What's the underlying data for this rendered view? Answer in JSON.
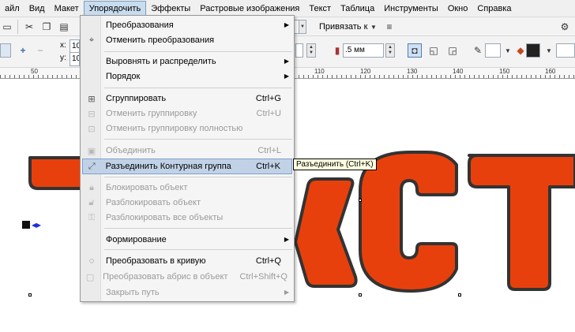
{
  "menubar": {
    "items": [
      "айл",
      "Вид",
      "Макет",
      "Упорядочить",
      "Эффекты",
      "Растровые изображения",
      "Текст",
      "Таблица",
      "Инструменты",
      "Окно",
      "Справка"
    ],
    "active_index": 3
  },
  "toolbar1": {
    "snap_label": "Привязать к",
    "field_value": ""
  },
  "toolbar2": {
    "x_label": "x:",
    "x_value": "10",
    "y_label": "y:",
    "y_value": "10",
    "outline_width": ".5 мм"
  },
  "ruler": {
    "labels": [
      "50",
      "110",
      "120",
      "130",
      "140",
      "150",
      "160"
    ]
  },
  "canvas": {
    "text": "TEКСТ",
    "fill_color": "#e8400c",
    "outline_color": "#333333"
  },
  "dropdown": {
    "items": [
      {
        "label": "Преобразования",
        "shortcut": "",
        "submenu": true,
        "disabled": false,
        "icon": ""
      },
      {
        "label": "Отменить преобразования",
        "shortcut": "",
        "submenu": false,
        "disabled": false,
        "icon": ""
      },
      {
        "label": "Выровнять и распределить",
        "shortcut": "",
        "submenu": true,
        "disabled": false,
        "icon": ""
      },
      {
        "label": "Порядок",
        "shortcut": "",
        "submenu": true,
        "disabled": false,
        "icon": ""
      },
      {
        "label": "Сгруппировать",
        "shortcut": "Ctrl+G",
        "submenu": false,
        "disabled": false,
        "icon": "group-icon"
      },
      {
        "label": "Отменить группировку",
        "shortcut": "Ctrl+U",
        "submenu": false,
        "disabled": true,
        "icon": "ungroup-icon"
      },
      {
        "label": "Отменить группировку полностью",
        "shortcut": "",
        "submenu": false,
        "disabled": true,
        "icon": "ungroup-all-icon"
      },
      {
        "label": "Объединить",
        "shortcut": "Ctrl+L",
        "submenu": false,
        "disabled": true,
        "icon": "combine-icon"
      },
      {
        "label": "Разъединить Контурная группа",
        "shortcut": "Ctrl+K",
        "submenu": false,
        "disabled": false,
        "icon": "break-apart-icon",
        "highlighted": true
      },
      {
        "label": "Блокировать объект",
        "shortcut": "",
        "submenu": false,
        "disabled": true,
        "icon": "lock-icon"
      },
      {
        "label": "Разблокировать объект",
        "shortcut": "",
        "submenu": false,
        "disabled": true,
        "icon": "unlock-icon"
      },
      {
        "label": "Разблокировать все объекты",
        "shortcut": "",
        "submenu": false,
        "disabled": true,
        "icon": "unlock-all-icon"
      },
      {
        "label": "Формирование",
        "shortcut": "",
        "submenu": true,
        "disabled": false,
        "icon": ""
      },
      {
        "label": "Преобразовать в кривую",
        "shortcut": "Ctrl+Q",
        "submenu": false,
        "disabled": false,
        "icon": "convert-to-curves-icon"
      },
      {
        "label": "Преобразовать абрис в объект",
        "shortcut": "Ctrl+Shift+Q",
        "submenu": false,
        "disabled": true,
        "icon": "outline-to-object-icon"
      },
      {
        "label": "Закрыть путь",
        "shortcut": "",
        "submenu": true,
        "disabled": true,
        "icon": ""
      }
    ]
  },
  "tooltip": {
    "text": "Разъединить (Ctrl+K)"
  },
  "colors": {
    "menu_highlight": "#c1d2e7",
    "accent_border": "#7da2ce",
    "text_fill": "#e8400c"
  }
}
